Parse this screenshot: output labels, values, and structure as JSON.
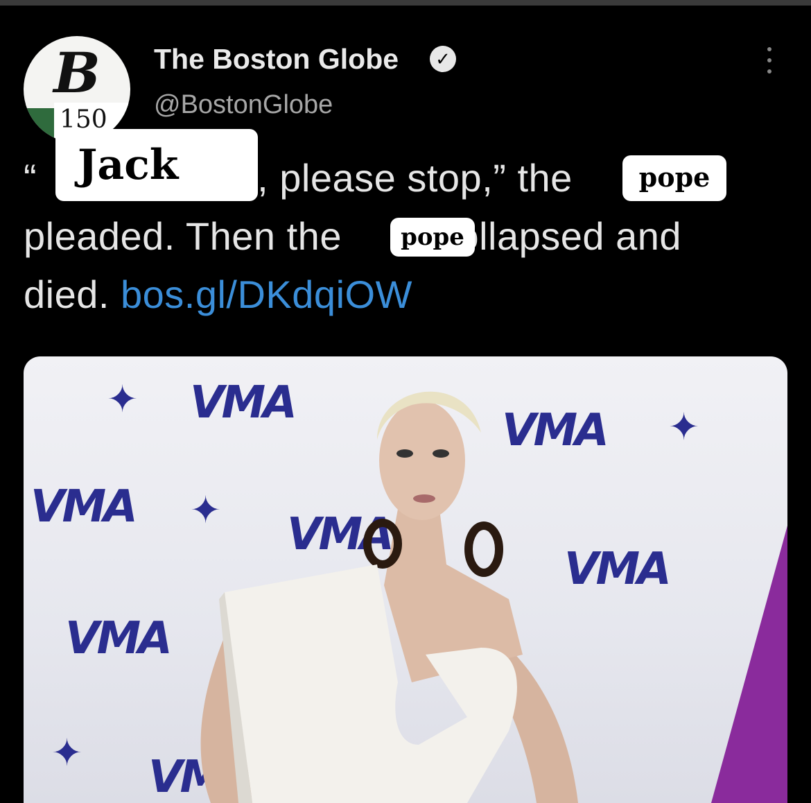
{
  "account": {
    "name": "The Boston Globe",
    "handle": "@BostonGlobe",
    "verified": true,
    "avatar_monogram": "B",
    "avatar_badge": "150"
  },
  "tweet": {
    "open_quote": "“",
    "line1_rest": ", please stop,” the",
    "line2_a": "pleaded. Then the",
    "line2_b": "collapsed and",
    "line3_a": "died.",
    "link": "bos.gl/DKdqiOW"
  },
  "stickers": {
    "name": "Jack",
    "word1": "pope",
    "word2": "pope"
  },
  "photo": {
    "backdrop_text": "VMA"
  },
  "icons": {
    "verified": "verified-check-icon",
    "more": "more-vertical-icon"
  },
  "colors": {
    "background": "#000000",
    "link": "#3b8ed9",
    "avatar_band": "#2f6b3d",
    "backdrop_blue": "#2a2d8f",
    "backdrop_purple": "#8a2b9c"
  }
}
